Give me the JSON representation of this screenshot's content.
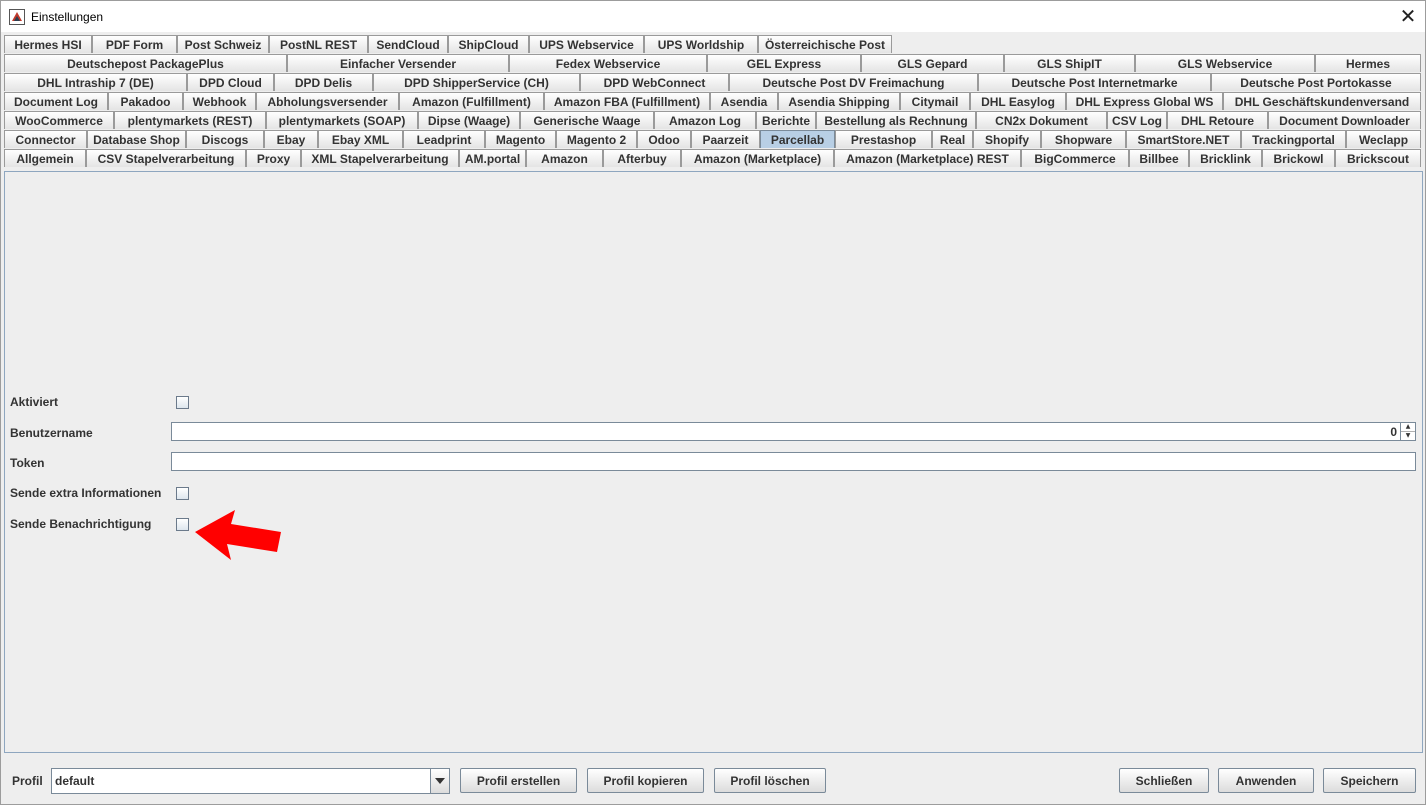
{
  "window": {
    "title": "Einstellungen",
    "close_glyph": "✕"
  },
  "tab_rows": [
    [
      "Hermes HSI",
      "PDF Form",
      "Post Schweiz",
      "PostNL REST",
      "SendCloud",
      "ShipCloud",
      "UPS Webservice",
      "UPS Worldship",
      "Österreichische Post"
    ],
    [
      "Deutschepost PackagePlus",
      "Einfacher Versender",
      "Fedex Webservice",
      "GEL Express",
      "GLS Gepard",
      "GLS ShipIT",
      "GLS Webservice",
      "Hermes"
    ],
    [
      "DHL Intraship 7 (DE)",
      "DPD Cloud",
      "DPD Delis",
      "DPD ShipperService (CH)",
      "DPD WebConnect",
      "Deutsche Post DV Freimachung",
      "Deutsche Post Internetmarke",
      "Deutsche Post Portokasse"
    ],
    [
      "Document Log",
      "Pakadoo",
      "Webhook",
      "Abholungsversender",
      "Amazon (Fulfillment)",
      "Amazon FBA (Fulfillment)",
      "Asendia",
      "Asendia Shipping",
      "Citymail",
      "DHL Easylog",
      "DHL Express Global WS",
      "DHL Geschäftskundenversand"
    ],
    [
      "WooCommerce",
      "plentymarkets (REST)",
      "plentymarkets (SOAP)",
      "Dipse (Waage)",
      "Generische Waage",
      "Amazon Log",
      "Berichte",
      "Bestellung als Rechnung",
      "CN2x Dokument",
      "CSV Log",
      "DHL Retoure",
      "Document Downloader"
    ],
    [
      "Connector",
      "Database Shop",
      "Discogs",
      "Ebay",
      "Ebay XML",
      "Leadprint",
      "Magento",
      "Magento 2",
      "Odoo",
      "Paarzeit",
      "Parcellab",
      "Prestashop",
      "Real",
      "Shopify",
      "Shopware",
      "SmartStore.NET",
      "Trackingportal",
      "Weclapp"
    ],
    [
      "Allgemein",
      "CSV Stapelverarbeitung",
      "Proxy",
      "XML Stapelverarbeitung",
      "AM.portal",
      "Amazon",
      "Afterbuy",
      "Amazon (Marketplace)",
      "Amazon (Marketplace) REST",
      "BigCommerce",
      "Billbee",
      "Bricklink",
      "Brickowl",
      "Brickscout"
    ]
  ],
  "selected_tab": "Parcellab",
  "form": {
    "aktiviert_label": "Aktiviert",
    "aktiviert_checked": false,
    "benutzername_label": "Benutzername",
    "benutzername_value": "0",
    "token_label": "Token",
    "token_value": "",
    "extra_info_label": "Sende extra Informationen",
    "extra_info_checked": false,
    "benachrichtigung_label": "Sende Benachrichtigung",
    "benachrichtigung_checked": false
  },
  "annotation": {
    "arrow_color": "#ff0000",
    "icon": "red-arrow-icon"
  },
  "bottom": {
    "profil_label": "Profil",
    "profil_value": "default",
    "profil_erstellen": "Profil erstellen",
    "profil_kopieren": "Profil kopieren",
    "profil_loeschen": "Profil löschen",
    "schliessen": "Schließen",
    "anwenden": "Anwenden",
    "speichern": "Speichern"
  }
}
